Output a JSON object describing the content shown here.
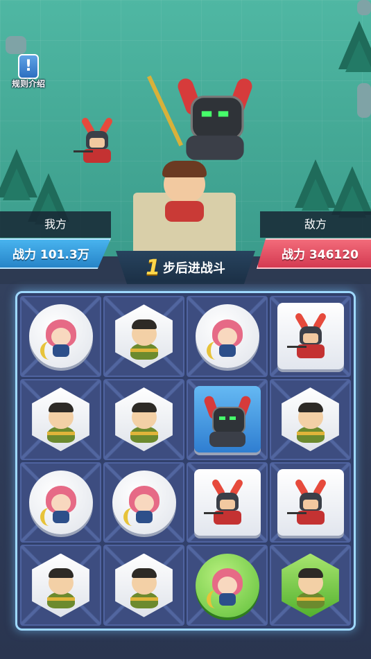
{
  "rules": {
    "label": "规则介绍",
    "icon": "exclamation-book-icon"
  },
  "teams": {
    "ally_label": "我方",
    "enemy_label": "敌方"
  },
  "power": {
    "ally_prefix": "战力",
    "ally_value": "101.3万",
    "enemy_prefix": "战力",
    "enemy_value": "346120"
  },
  "countdown": {
    "steps": "1",
    "text": "步后进战斗"
  },
  "colors": {
    "ally": "#2784c8",
    "enemy": "#d43a52",
    "board_border": "#9fd9ff",
    "highlight": "#5fbf3a"
  },
  "board": {
    "rows": [
      [
        {
          "unit": "pink-hair-girl",
          "shape": "circle"
        },
        {
          "unit": "green-monk",
          "shape": "hexagon"
        },
        {
          "unit": "pink-hair-girl",
          "shape": "circle"
        },
        {
          "unit": "red-horn-warrior",
          "shape": "square"
        }
      ],
      [
        {
          "unit": "green-monk",
          "shape": "hexagon"
        },
        {
          "unit": "green-monk",
          "shape": "hexagon"
        },
        {
          "unit": "dark-armored-boss",
          "shape": "square-blue"
        },
        {
          "unit": "green-monk",
          "shape": "hexagon"
        }
      ],
      [
        {
          "unit": "pink-hair-girl",
          "shape": "circle"
        },
        {
          "unit": "pink-hair-girl",
          "shape": "circle"
        },
        {
          "unit": "red-horn-warrior",
          "shape": "square"
        },
        {
          "unit": "red-horn-warrior",
          "shape": "square"
        }
      ],
      [
        {
          "unit": "green-monk",
          "shape": "hexagon"
        },
        {
          "unit": "green-monk",
          "shape": "hexagon"
        },
        {
          "unit": "pink-hair-girl",
          "shape": "circle-green"
        },
        {
          "unit": "green-monk",
          "shape": "hexagon-green"
        }
      ]
    ]
  }
}
